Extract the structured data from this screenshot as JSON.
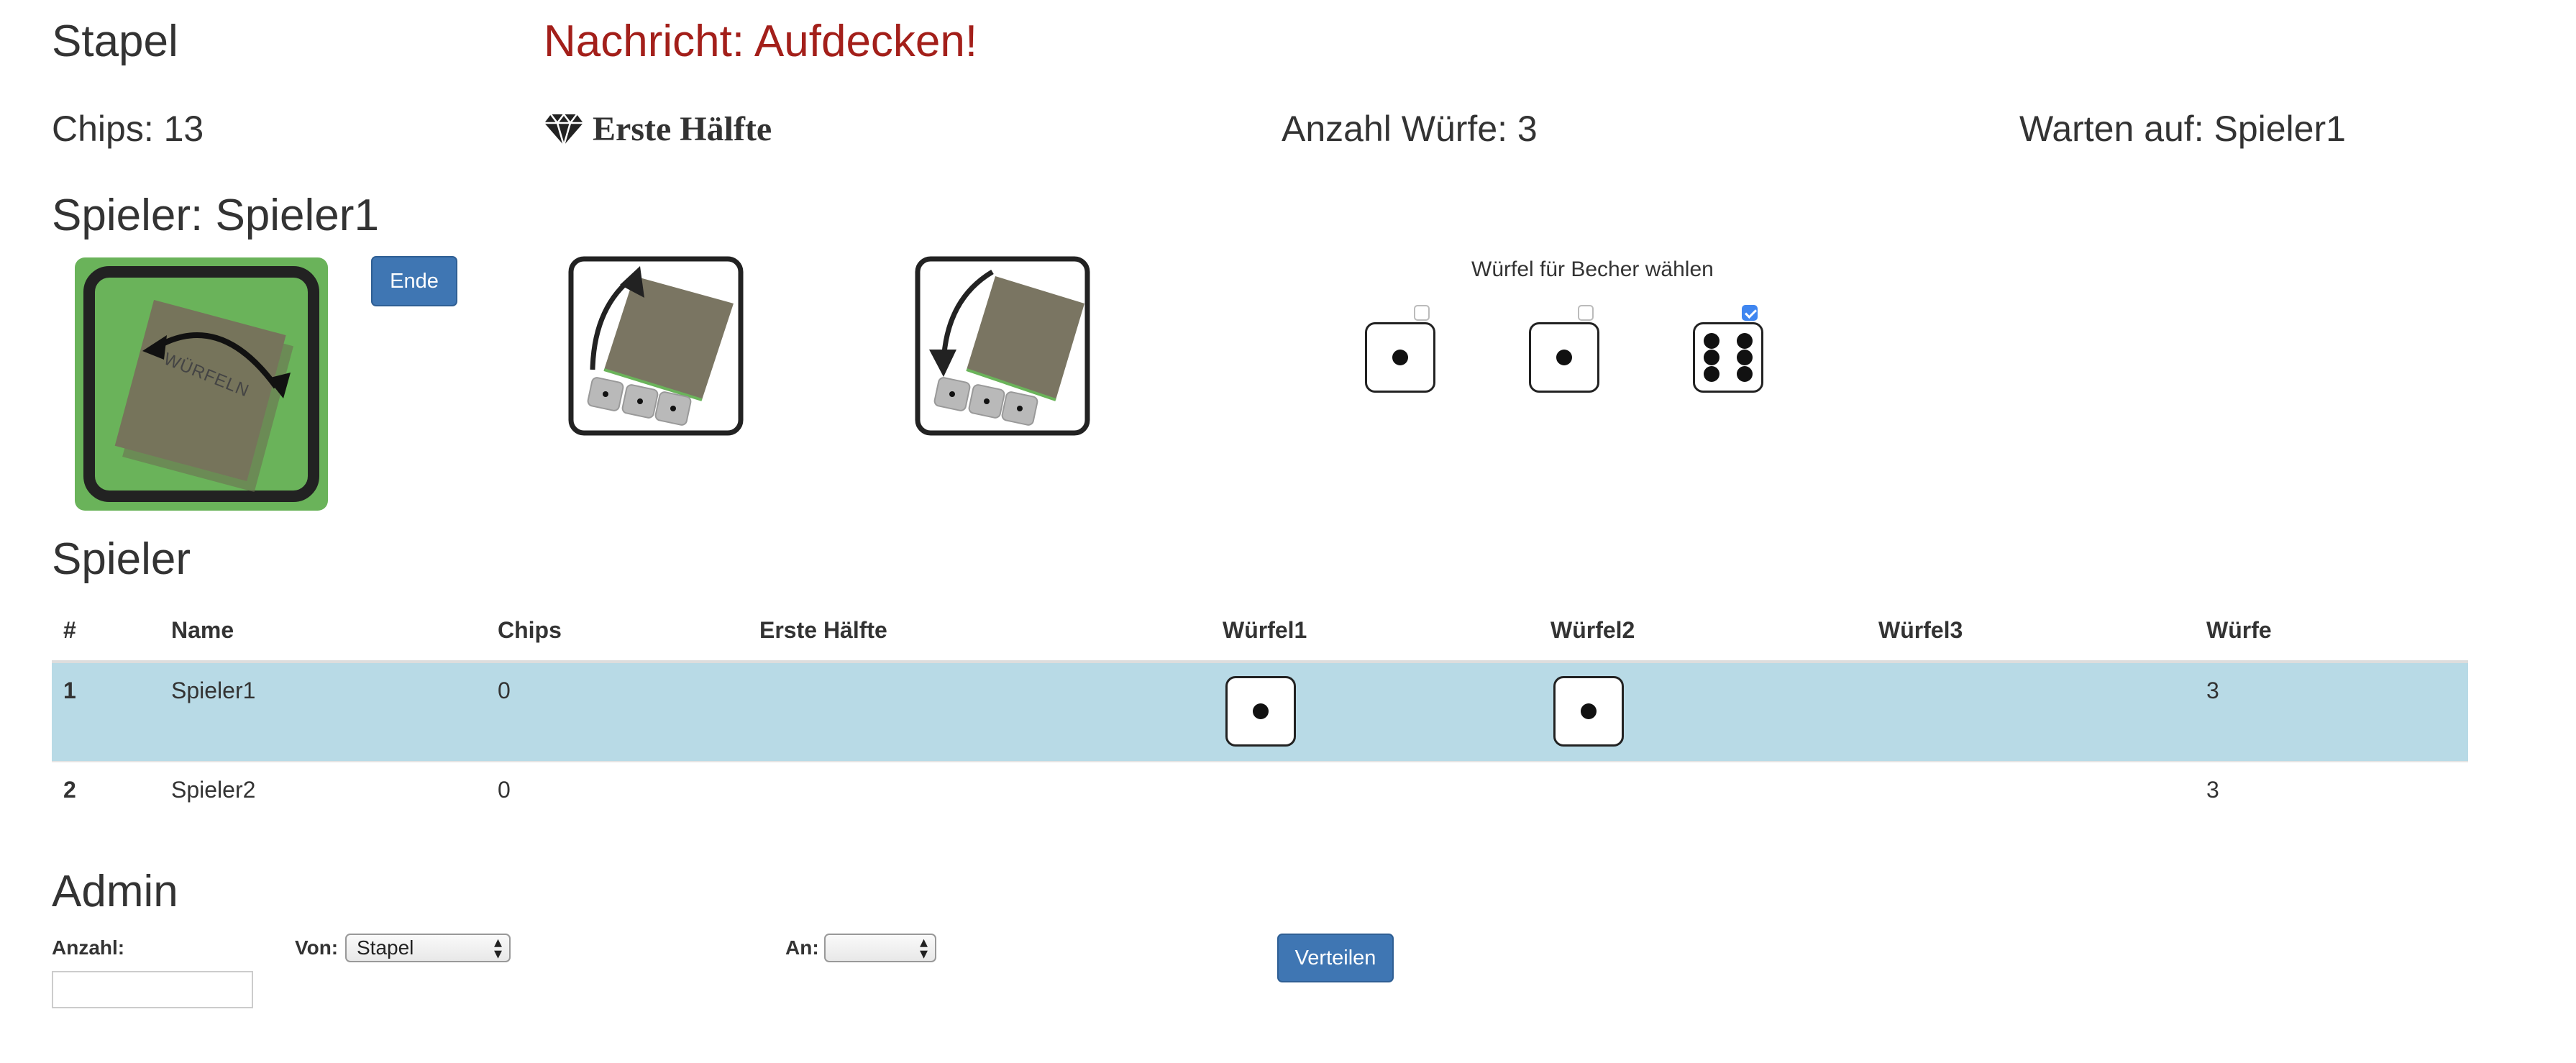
{
  "header": {
    "stack_title": "Stapel",
    "message": "Nachricht: Aufdecken!",
    "chips": "Chips: 13",
    "first_half": "Erste Hälfte",
    "throw_count": "Anzahl Würfe: 3",
    "waiting_for": "Warten auf: Spieler1"
  },
  "player": {
    "title": "Spieler: Spieler1",
    "end_button": "Ende",
    "cup_label": "WÜRFELN",
    "choose_label": "Würfel für Becher wählen",
    "dice": [
      {
        "value": 1,
        "checked": false
      },
      {
        "value": 1,
        "checked": false
      },
      {
        "value": 6,
        "checked": true
      }
    ]
  },
  "players_section": {
    "title": "Spieler",
    "columns": [
      "#",
      "Name",
      "Chips",
      "Erste Hälfte",
      "Würfel1",
      "Würfel2",
      "Würfel3",
      "Würfe"
    ],
    "rows": [
      {
        "num": "1",
        "name": "Spieler1",
        "chips": "0",
        "first_half": "",
        "d1": 1,
        "d2": 1,
        "d3": null,
        "throws": "3",
        "highlight": true
      },
      {
        "num": "2",
        "name": "Spieler2",
        "chips": "0",
        "first_half": "",
        "d1": null,
        "d2": null,
        "d3": null,
        "throws": "3",
        "highlight": false
      }
    ]
  },
  "admin": {
    "title": "Admin",
    "amount_label": "Anzahl:",
    "amount_value": "",
    "from_label": "Von:",
    "from_value": "Stapel",
    "to_label": "An:",
    "to_value": "",
    "distribute_button": "Verteilen"
  },
  "colors": {
    "message": "#a31f1a",
    "button": "#3f76b3",
    "highlight_row": "#b8dae6",
    "cup_green": "#6ab35a"
  }
}
